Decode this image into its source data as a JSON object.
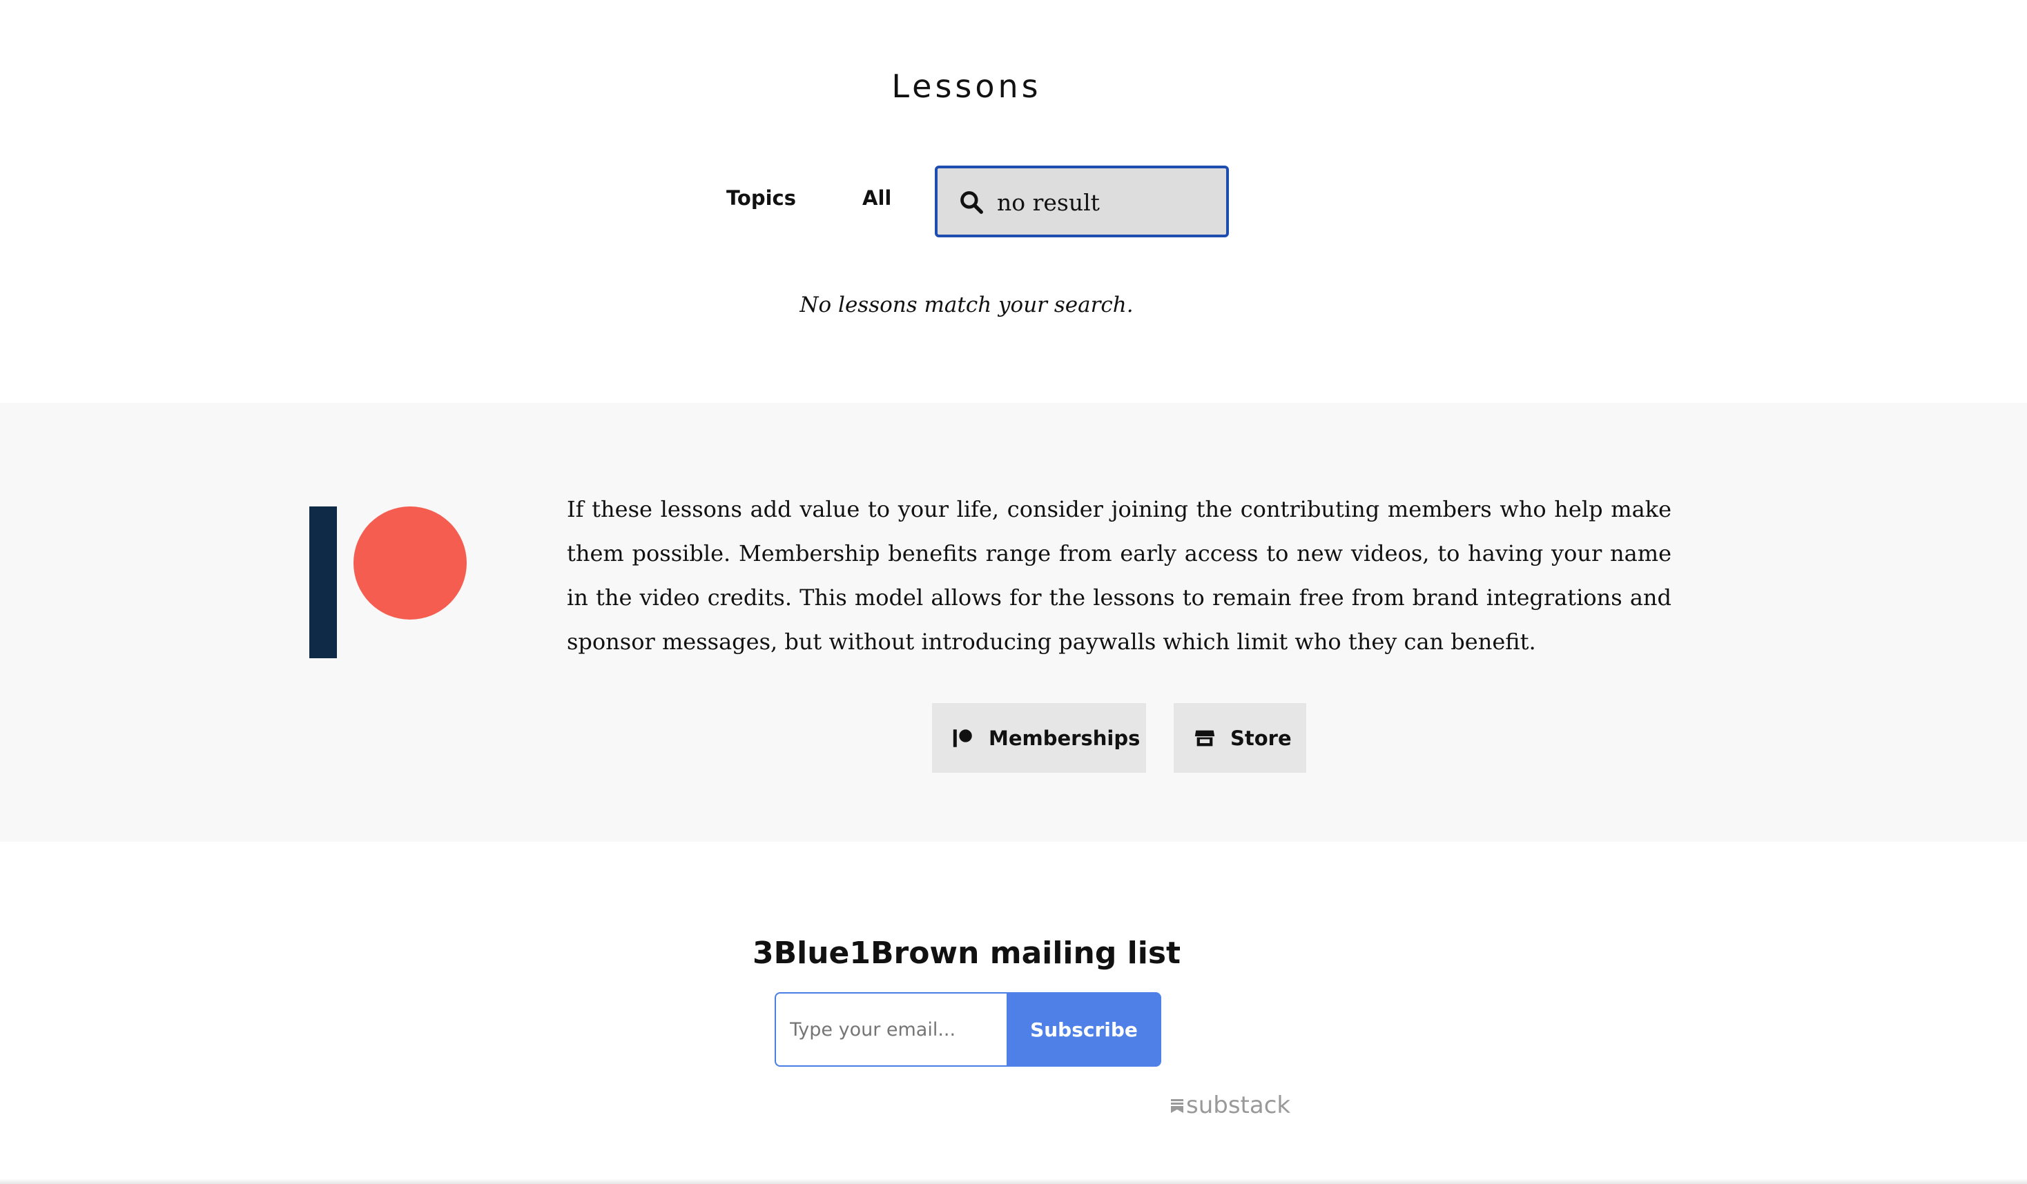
{
  "lessons": {
    "title": "Lessons",
    "tabs": [
      {
        "label": "Topics"
      },
      {
        "label": "All"
      }
    ],
    "search": {
      "value": "no result",
      "placeholder": ""
    },
    "empty_message": "No lessons match your search."
  },
  "support": {
    "text": "If these lessons add value to your life, consider joining the contributing members who help make them possible. Membership benefits range from early access to new videos, to having your name in the video credits. This model allows for the lessons to remain free from brand integrations and sponsor messages, but without introducing paywalls which limit who they can benefit.",
    "buttons": [
      {
        "label": "Memberships",
        "icon": "patreon-icon"
      },
      {
        "label": "Store",
        "icon": "store-icon"
      }
    ],
    "colors": {
      "patreon_bar": "#0f2a47",
      "patreon_circle": "#f45d4f",
      "background": "#f8f8f8"
    }
  },
  "mailing_list": {
    "title": "3Blue1Brown mailing list",
    "email_placeholder": "Type your email...",
    "subscribe_label": "Subscribe",
    "powered_by": "substack",
    "accent": "#4f80e8"
  }
}
